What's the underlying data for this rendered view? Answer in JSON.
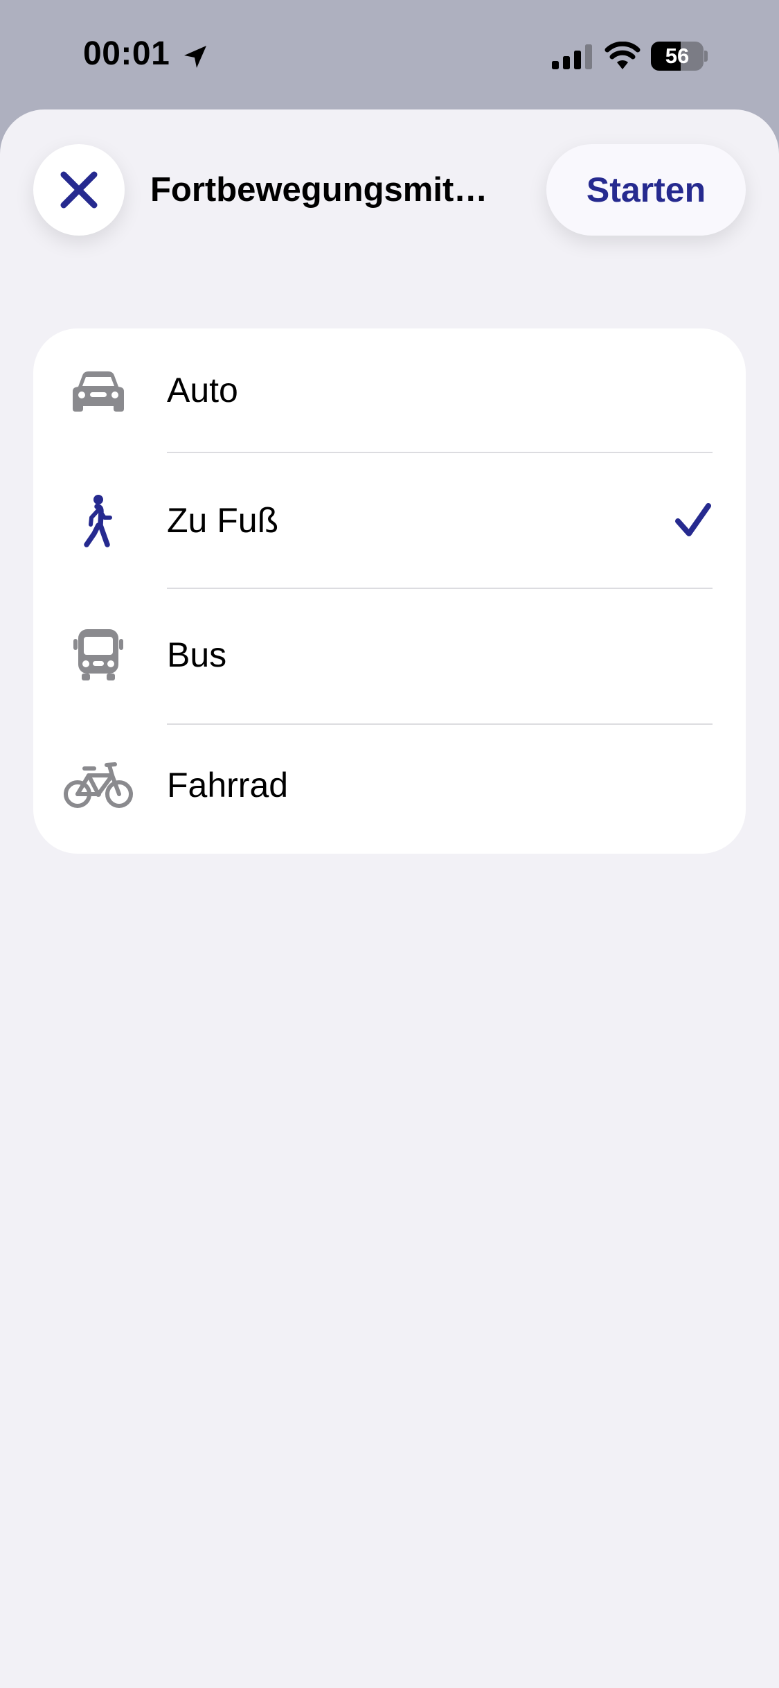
{
  "status_bar": {
    "time": "00:01",
    "battery_level": "56",
    "battery_fraction": 0.56,
    "icons": [
      "location-arrow-icon",
      "cellular-signal-icon",
      "wifi-icon",
      "battery-icon"
    ]
  },
  "header": {
    "title": "Fortbewegungsmit…",
    "close_icon": "close-icon",
    "start_label": "Starten"
  },
  "options": [
    {
      "label": "Auto",
      "icon": "car-icon",
      "selected": false
    },
    {
      "label": "Zu Fuß",
      "icon": "walking-icon",
      "selected": true
    },
    {
      "label": "Bus",
      "icon": "bus-icon",
      "selected": false
    },
    {
      "label": "Fahrrad",
      "icon": "bicycle-icon",
      "selected": false
    }
  ],
  "colors": {
    "accent": "#262a8f",
    "sheet_background": "#f2f1f6",
    "backdrop": "#aeb0bf",
    "icon_gray": "#8a8a8e"
  }
}
